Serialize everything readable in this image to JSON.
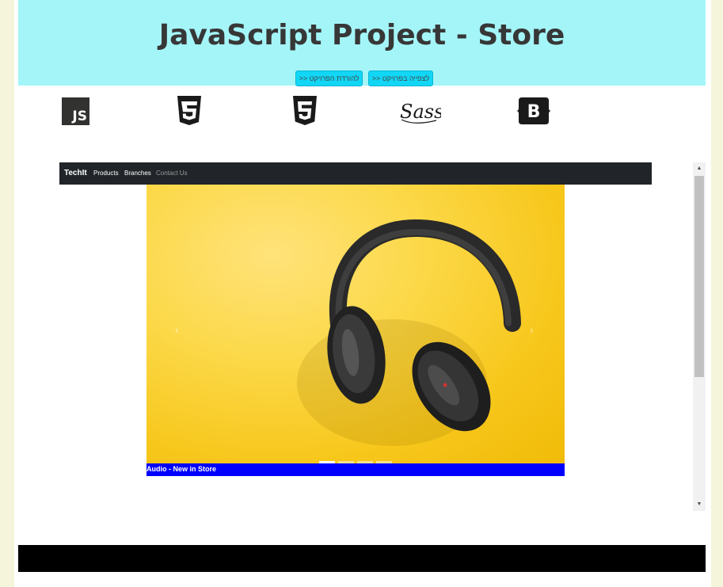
{
  "header": {
    "title": "JavaScript Project - Store",
    "download_button": "להורדת הפרויקט <<",
    "view_button": "לצפייה בפרויקט <<"
  },
  "tech_icons": {
    "js_label": "JS",
    "sass_label": "Sass",
    "bootstrap_label": "B",
    "colors": {
      "js_bg": "#323330",
      "icon_fill": "#1a1a1a"
    }
  },
  "preview": {
    "navbar": {
      "brand": "TechIt",
      "links": [
        "Products",
        "Branches",
        "Contact Us"
      ]
    },
    "carousel": {
      "prev_arrow": "‹",
      "next_arrow": "›",
      "slide_count": 4,
      "active_slide": 1,
      "caption": "Audio - New in Store",
      "image": "headphones on yellow background"
    },
    "scrollbar": {
      "up": "▲",
      "down": "▼"
    }
  },
  "colors": {
    "header_bg": "#a4f5f8",
    "button_bg": "#12d6f5",
    "caption_bg": "#0000ff",
    "footer_bg": "#000000",
    "page_bg": "#f5f5dc"
  }
}
